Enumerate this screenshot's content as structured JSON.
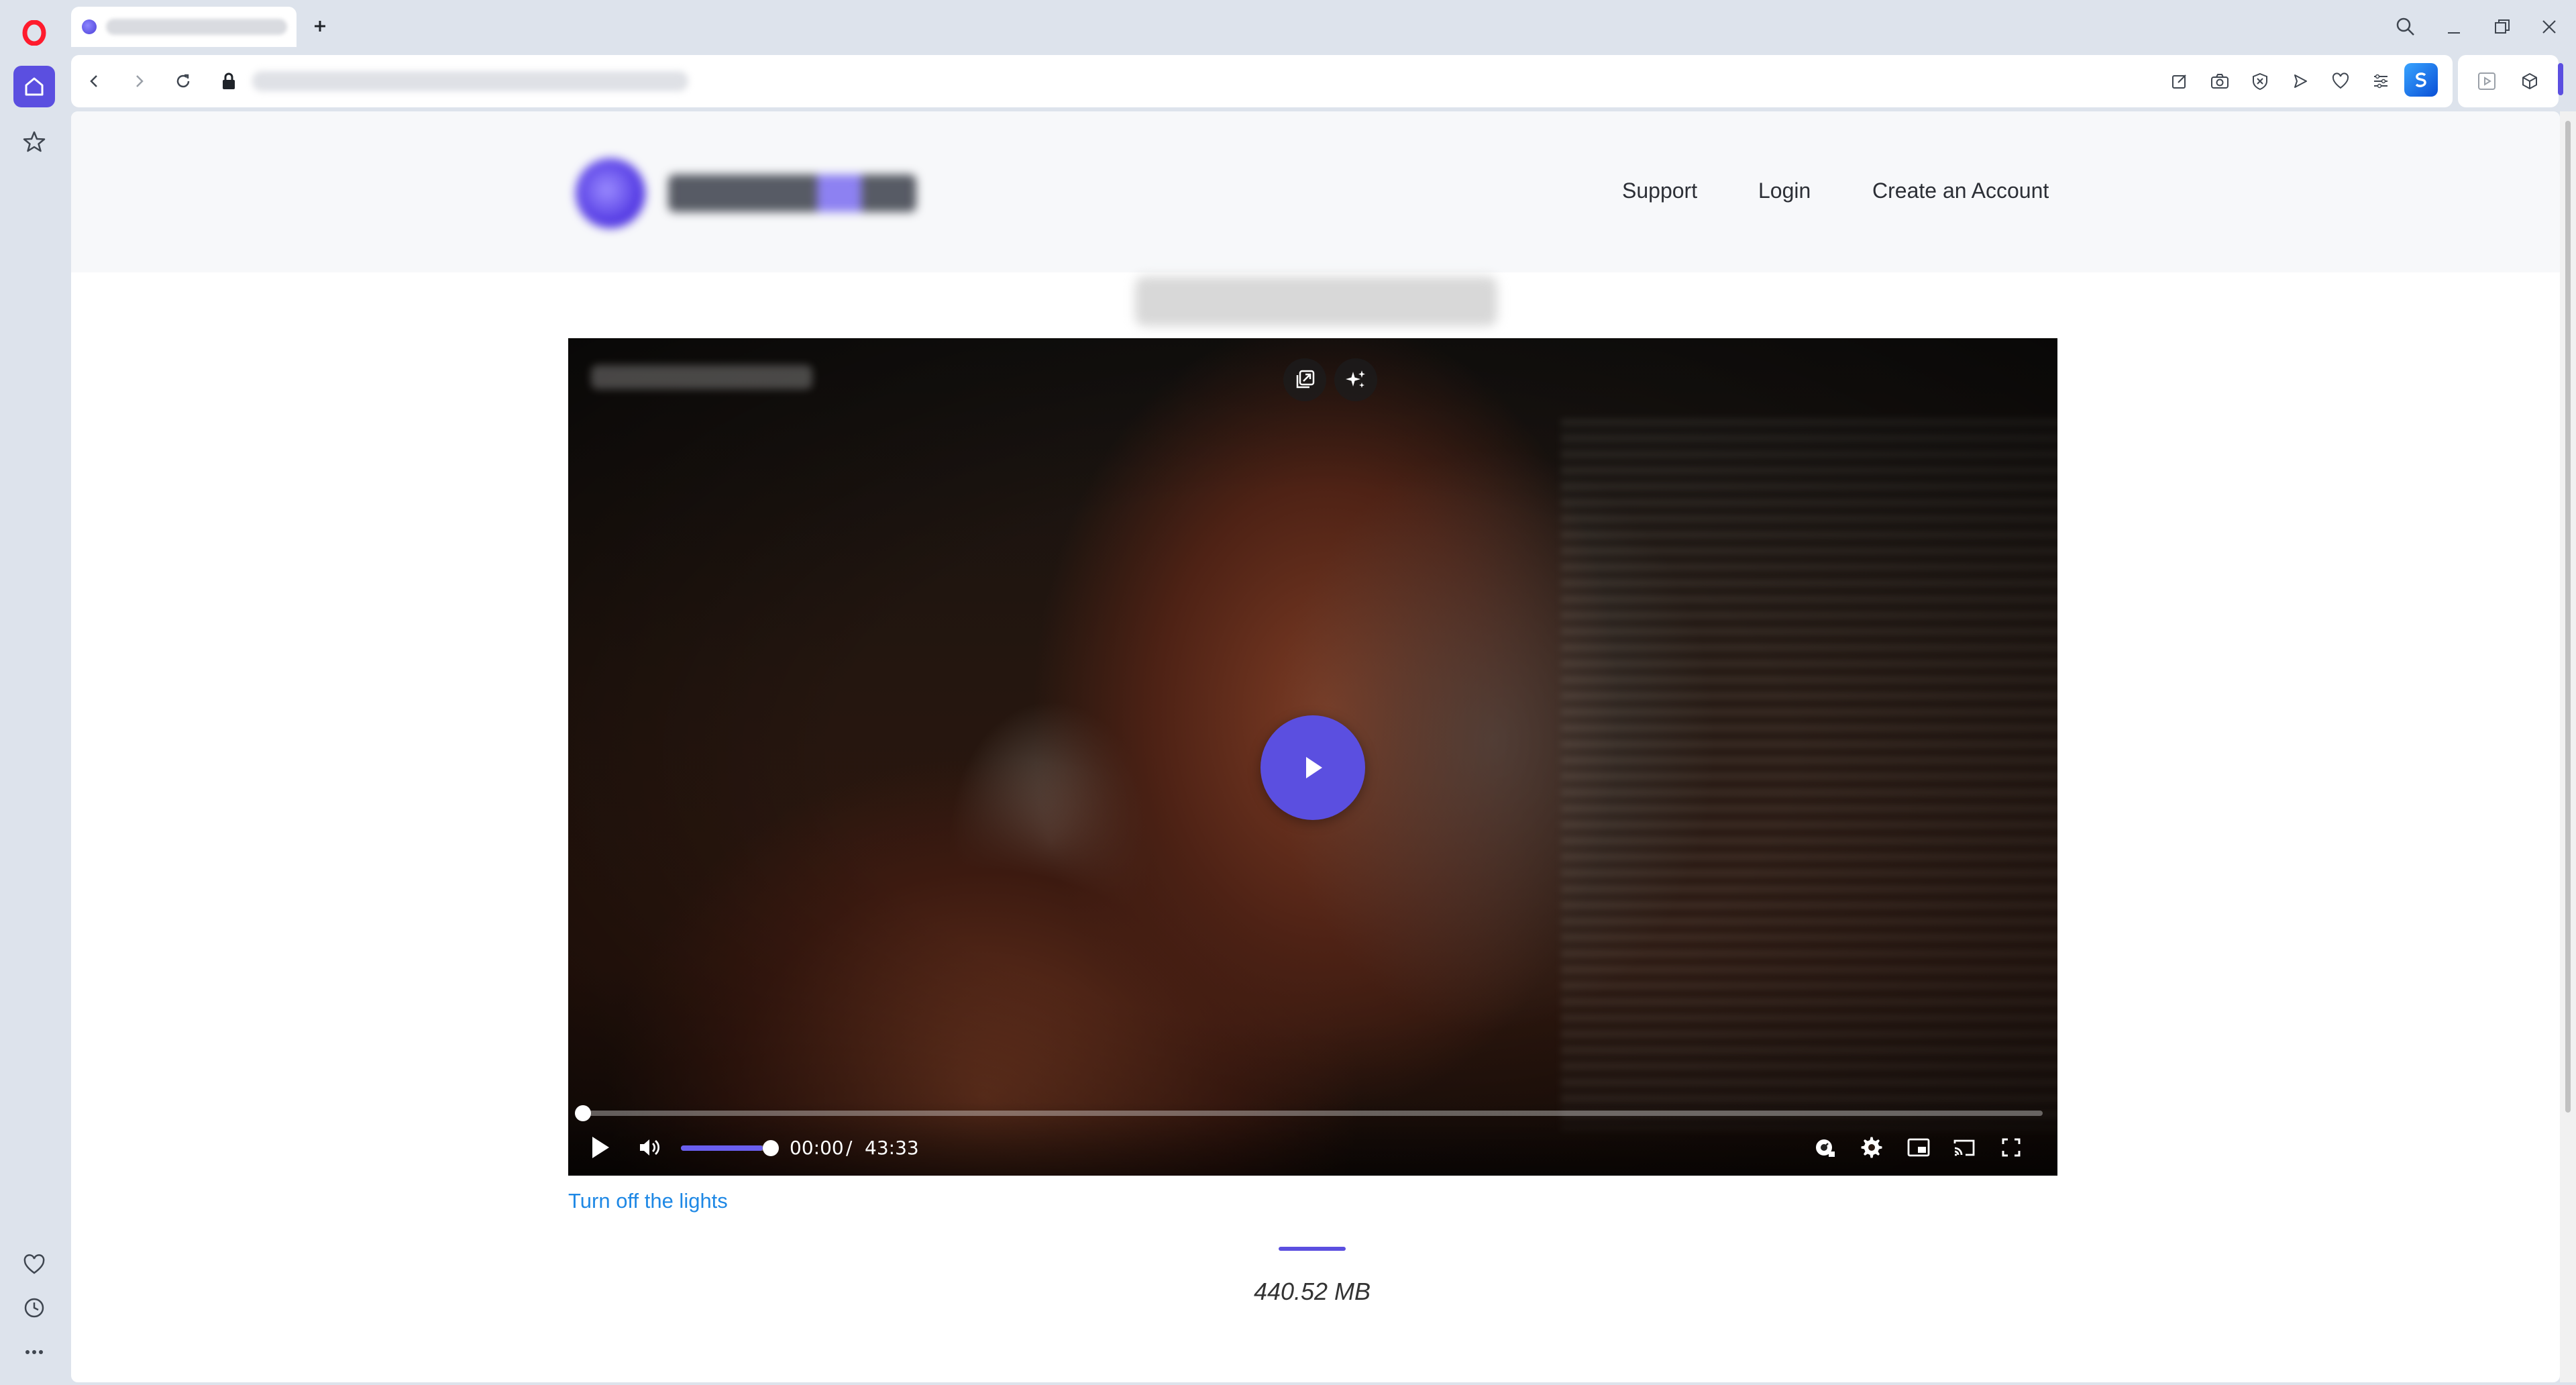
{
  "browser": {
    "tab": {
      "favicon": "site-favicon"
    },
    "icons": {
      "sidebar_top": [
        "opera-logo-icon",
        "home-icon",
        "star-icon"
      ],
      "sidebar_bottom": [
        "heart-icon",
        "clock-icon",
        "more-icon"
      ],
      "address_tools": [
        "edit-icon",
        "camera-icon",
        "shield-icon",
        "send-icon",
        "heart-icon",
        "menu-lines-icon",
        "extension-icon"
      ]
    },
    "accent_color": "#5b4fe0"
  },
  "site": {
    "nav": {
      "support": "Support",
      "login": "Login",
      "create_account": "Create an Account"
    }
  },
  "video": {
    "current_time": "00:00",
    "separator": "/",
    "duration": "43:33",
    "progress": 0,
    "volume": 0.9,
    "play_button_color": "#5b4fe0"
  },
  "page": {
    "lights_link": "Turn off the lights",
    "file_size": "440.52 MB"
  }
}
